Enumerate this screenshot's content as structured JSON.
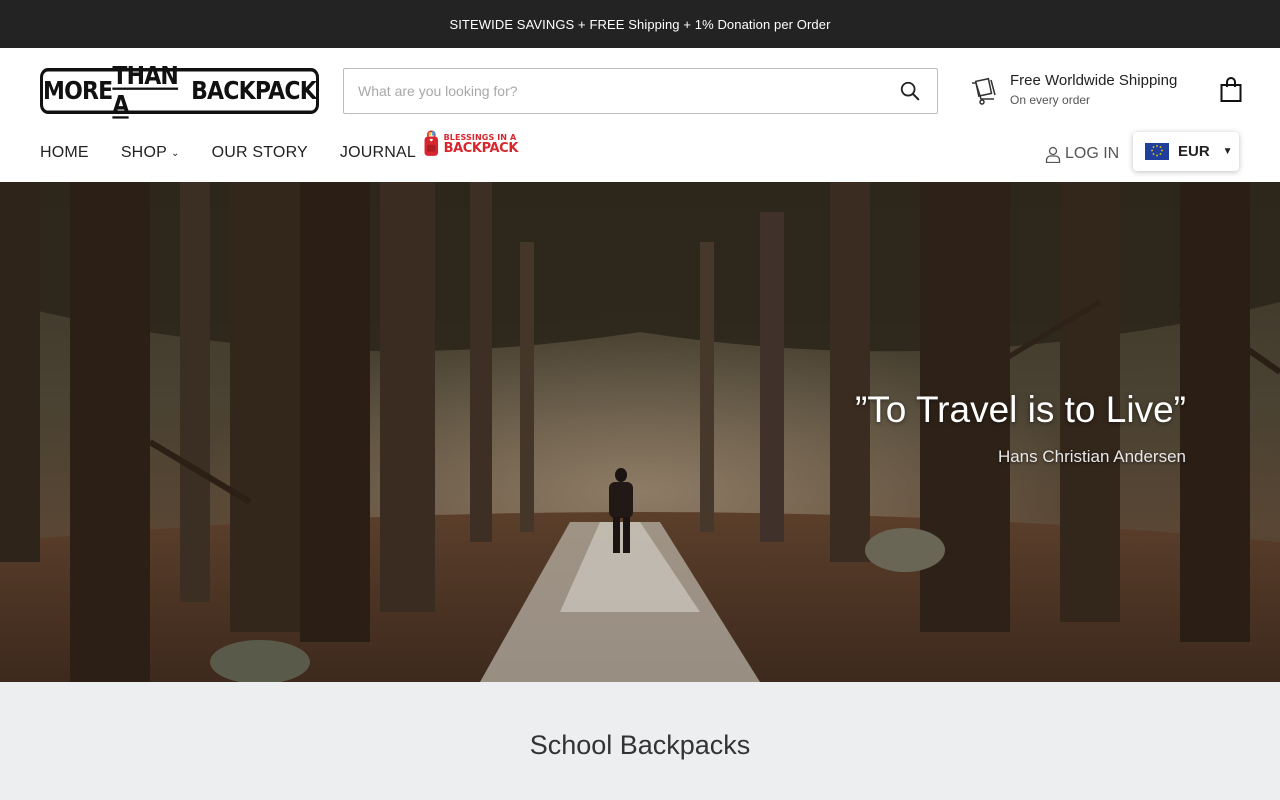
{
  "announcement": {
    "text": "SITEWIDE SAVINGS + FREE Shipping + 1% Donation per Order"
  },
  "header": {
    "logo": {
      "part1": "MORE ",
      "part2": "THAN A",
      "part3": " BACKPACK"
    },
    "search": {
      "placeholder": "What are you looking for?",
      "value": "",
      "icon": "search-icon"
    },
    "shipping": {
      "title": "Free Worldwide Shipping",
      "subtitle": "On every order",
      "icon": "shipping-cart-icon"
    },
    "cart": {
      "icon": "shopping-bag-icon"
    }
  },
  "nav": {
    "items": [
      {
        "label": "HOME"
      },
      {
        "label": "SHOP",
        "has_dropdown": true,
        "chevron": "⌄"
      },
      {
        "label": "OUR STORY"
      },
      {
        "label": "JOURNAL"
      }
    ],
    "blessings": {
      "line1": "BLESSINGS IN A",
      "line2": "BACKPACK",
      "color": "#d8262f"
    },
    "login": {
      "label": "LOG IN",
      "icon": "user-icon"
    },
    "currency": {
      "code": "EUR",
      "caret": "▼",
      "flag": "eu-flag-icon"
    }
  },
  "hero": {
    "quote": "”To Travel is to Live”",
    "author": "Hans Christian Andersen"
  },
  "section": {
    "title": "School Backpacks"
  },
  "colors": {
    "announcement_bg": "#232323",
    "section_bg": "#eceef0",
    "brand_red": "#d8262f"
  }
}
